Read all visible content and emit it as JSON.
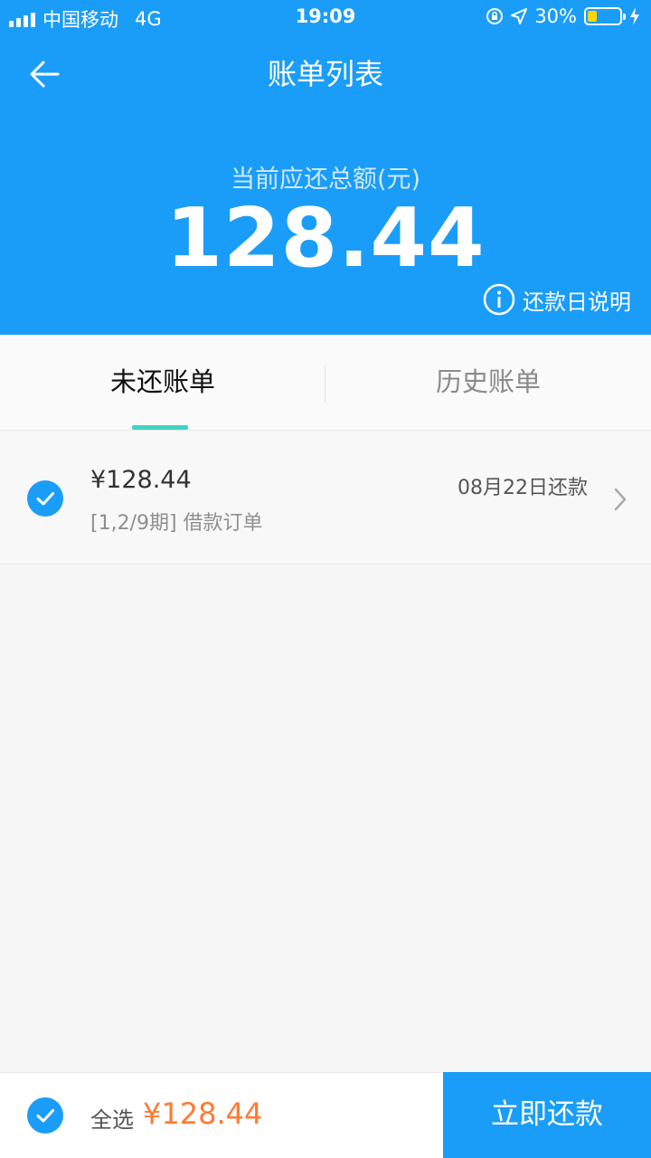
{
  "status_bar": {
    "carrier": "中国移动",
    "network": "4G",
    "time": "19:09",
    "battery": "30%",
    "battery_level": 0.3
  },
  "header": {
    "title": "账单列表",
    "amount_label": "当前应还总额(元)",
    "amount": "128.44",
    "repay_info": "还款日说明"
  },
  "tabs": [
    {
      "label": "未还账单",
      "active": true
    },
    {
      "label": "历史账单",
      "active": false
    }
  ],
  "bills": [
    {
      "amount": "¥128.44",
      "desc": "[1,2/9期] 借款订单",
      "due": "08月22日还款",
      "checked": true
    }
  ],
  "footer": {
    "select_all": "全选",
    "total": "¥128.44",
    "pay_button": "立即还款"
  },
  "colors": {
    "primary": "#1a9df8",
    "accent_teal": "#3fd3c0",
    "total_orange": "#ff7a32"
  }
}
